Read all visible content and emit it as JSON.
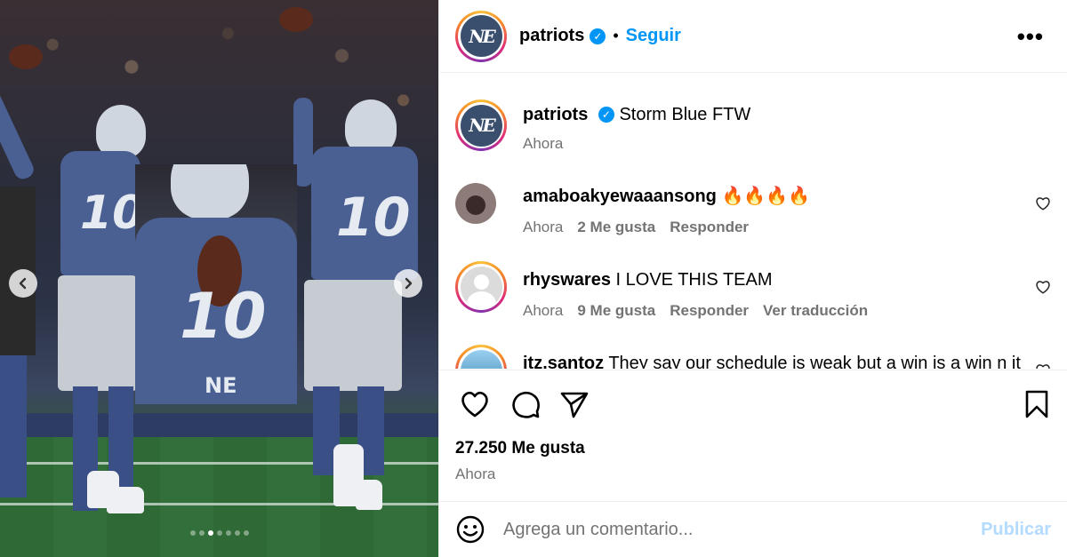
{
  "post": {
    "author": "patriots",
    "follow_label": "Seguir",
    "separator": "•",
    "more_icon": "more-horizontal-icon",
    "verified_icon": "verified-badge-icon",
    "logo_text": "NE",
    "image": {
      "jersey_number": "10",
      "chest_logo": "NE",
      "carousel_dots": 7,
      "active_dot": 2
    }
  },
  "caption": {
    "user": "patriots",
    "text": "Storm Blue FTW",
    "time": "Ahora"
  },
  "comments": [
    {
      "user": "amaboakyewaaansong",
      "text": "🔥🔥🔥🔥",
      "time": "Ahora",
      "likes": "2 Me gusta",
      "reply": "Responder",
      "translate": ""
    },
    {
      "user": "rhyswares",
      "text": "I LOVE THIS TEAM",
      "time": "Ahora",
      "likes": "9 Me gusta",
      "reply": "Responder",
      "translate": "Ver traducción"
    },
    {
      "user": "itz.santoz",
      "text": "They say our schedule is weak but a win is a win n it"
    }
  ],
  "summary": {
    "likes": "27.250 Me gusta",
    "time": "Ahora"
  },
  "composer": {
    "placeholder": "Agrega un comentario...",
    "publish_label": "Publicar"
  },
  "colors": {
    "accent": "#0095f6",
    "publish_disabled": "#b3dbff",
    "muted": "#737373"
  }
}
